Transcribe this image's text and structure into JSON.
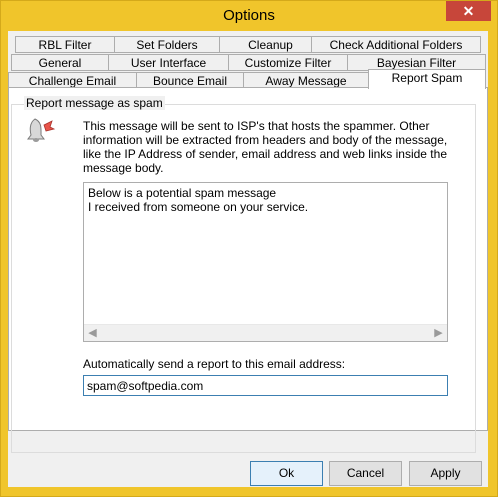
{
  "window": {
    "title": "Options",
    "close_glyph": "✕"
  },
  "tabs_row1": [
    "RBL Filter",
    "Set Folders",
    "Cleanup",
    "Check Additional Folders"
  ],
  "tabs_row2": [
    "General",
    "User Interface",
    "Customize Filter",
    "Bayesian Filter"
  ],
  "tabs_row3": [
    "Challenge Email",
    "Bounce Email",
    "Away Message",
    "Report Spam"
  ],
  "active_tab": "Report Spam",
  "report": {
    "group_label": "Report message as spam",
    "icon": "bell-icon",
    "info": "This message will be sent to ISP's that hosts the spammer. Other information will be extracted from headers and body of the message, like the IP Address of sender, email address and web links inside the message body.",
    "message_lines": [
      "Below is a potential spam message",
      "I received from someone on your service."
    ],
    "email_label": "Automatically send a report to this email address:",
    "email_value": "spam@softpedia.com"
  },
  "buttons": {
    "ok": "Ok",
    "cancel": "Cancel",
    "apply": "Apply"
  }
}
